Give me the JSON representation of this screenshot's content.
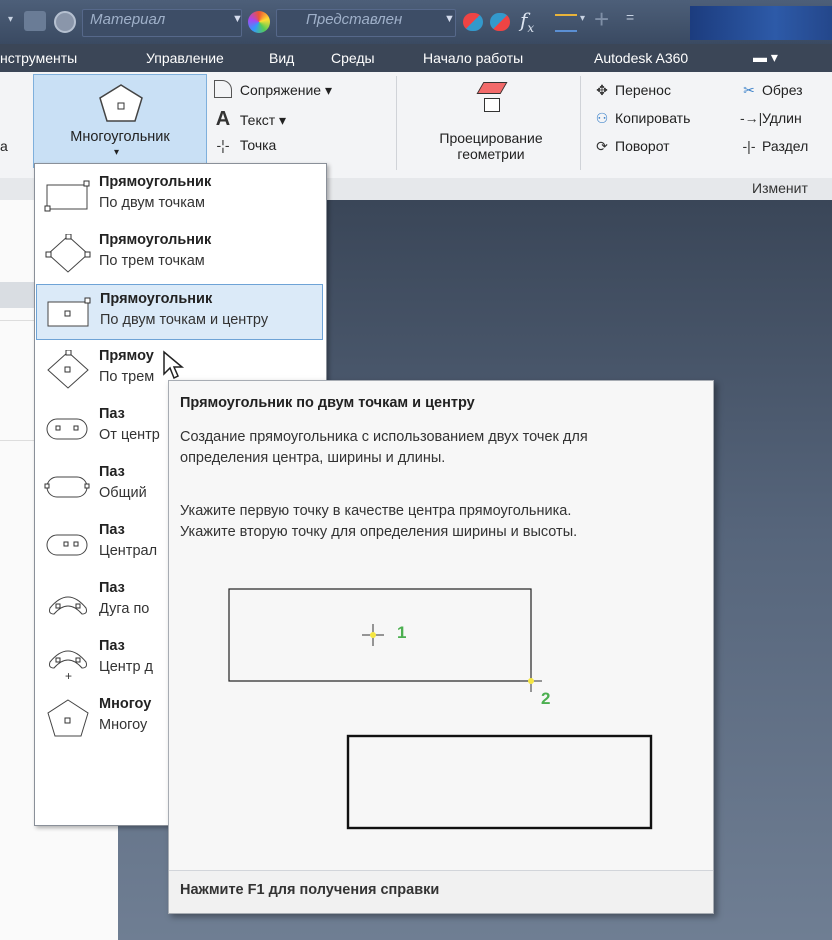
{
  "qat": {
    "material_placeholder": "Материал",
    "view_placeholder": "Представлен",
    "fx_icon": "fx-icon"
  },
  "tabs": [
    "нструменты",
    "Управление",
    "Вид",
    "Среды",
    "Начало работы",
    "Autodesk A360"
  ],
  "ribbon": {
    "big_button_label": "Многоугольник",
    "left_stub": "а",
    "draw": {
      "fillet": "Сопряжение",
      "text": "Текст",
      "point": "Точка"
    },
    "project": {
      "line1": "Проецирование",
      "line2": "геометрии"
    },
    "modify": {
      "move": "Перенос",
      "copy": "Копировать",
      "rotate": "Поворот",
      "trim": "Обрез",
      "extend": "Удлин",
      "split": "Раздел",
      "panel_label": "Изменит"
    }
  },
  "menu": [
    {
      "title": "Прямоугольник",
      "subtitle": "По двум точкам",
      "icon": "rectangle-two-point-icon"
    },
    {
      "title": "Прямоугольник",
      "subtitle": "По трем точкам",
      "icon": "rectangle-three-point-icon"
    },
    {
      "title": "Прямоугольник",
      "subtitle": "По двум точкам и центру",
      "icon": "rectangle-two-point-center-icon",
      "highlighted": true
    },
    {
      "title": "Прямоу",
      "subtitle": "По трем",
      "icon": "rectangle-three-point-center-icon"
    },
    {
      "title": "Паз",
      "subtitle": "От центр",
      "icon": "slot-center-to-center-icon"
    },
    {
      "title": "Паз",
      "subtitle": "Общий",
      "icon": "slot-overall-icon"
    },
    {
      "title": "Паз",
      "subtitle": "Централ",
      "icon": "slot-center-point-icon"
    },
    {
      "title": "Паз",
      "subtitle": "Дуга по",
      "icon": "slot-three-point-arc-icon"
    },
    {
      "title": "Паз",
      "subtitle": "Центр д",
      "icon": "slot-center-point-arc-icon"
    },
    {
      "title": "Многоу",
      "subtitle": "Многоу",
      "icon": "polygon-icon"
    }
  ],
  "tooltip": {
    "title": "Прямоугольник по двум точкам и центру",
    "desc1": "Создание прямоугольника с использованием двух точек для",
    "desc2": "определения центра, ширины и длины.",
    "desc3": "Укажите первую точку в качестве центра прямоугольника.",
    "desc4": "Укажите вторую точку для определения ширины и высоты.",
    "point1": "1",
    "point2": "2",
    "footer": "Нажмите F1 для получения справки"
  }
}
